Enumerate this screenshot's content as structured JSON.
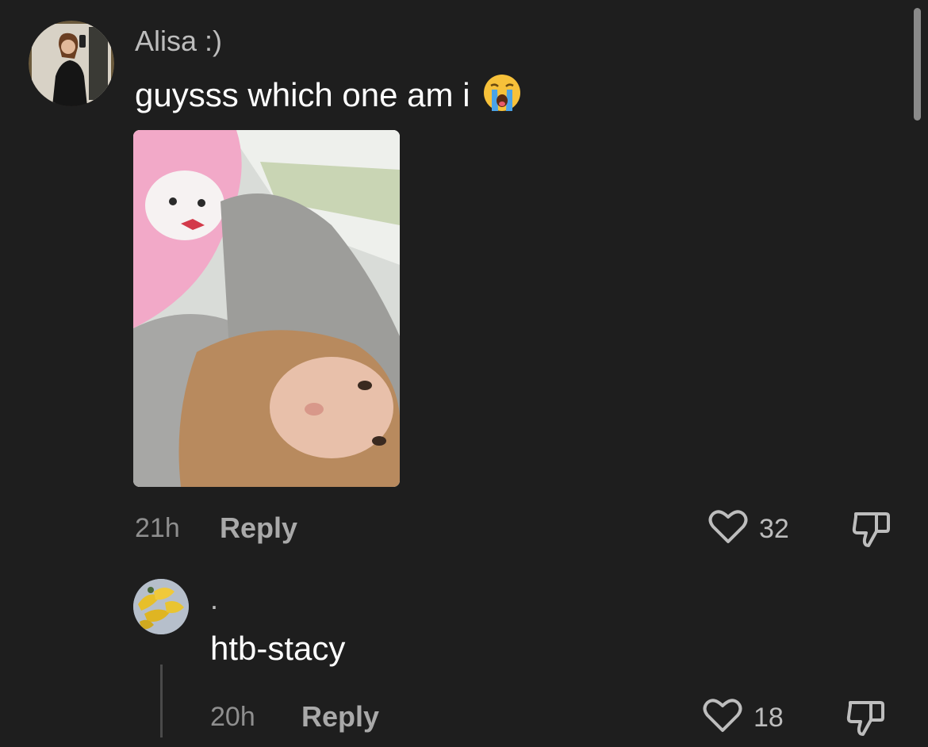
{
  "comments": [
    {
      "username": "Alisa :)",
      "text": "guysss which one am i",
      "emoji": "loudly-crying-face",
      "has_image": true,
      "time": "21h",
      "reply_label": "Reply",
      "likes": "32"
    },
    {
      "username": ".",
      "text": "htb-stacy",
      "time": "20h",
      "reply_label": "Reply",
      "likes": "18"
    }
  ],
  "colors": {
    "background": "#1e1e1e",
    "text_primary": "#ffffff",
    "text_secondary": "#bdbdbd",
    "text_muted": "#8f8f8f"
  },
  "icons": [
    "heart-outline-icon",
    "thumbs-down-icon"
  ]
}
